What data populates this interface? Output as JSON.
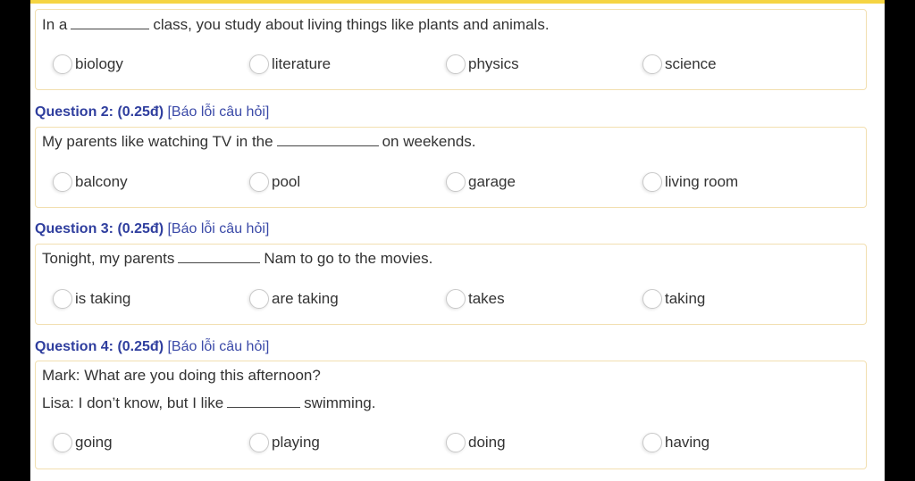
{
  "questions": [
    {
      "header": null,
      "lines": [
        {
          "before": "In a",
          "after": "class, you study about living things like plants and animals."
        }
      ],
      "options": [
        "biology",
        "literature",
        "physics",
        "science"
      ]
    },
    {
      "header": {
        "number": "Question 2: (0.25đ)",
        "link": "[Báo lỗi câu hỏi]"
      },
      "lines": [
        {
          "before": "My parents like watching TV in the",
          "after": "on weekends."
        }
      ],
      "options": [
        "balcony",
        "pool",
        "garage",
        "living room"
      ]
    },
    {
      "header": {
        "number": "Question 3: (0.25đ)",
        "link": "[Báo lỗi câu hỏi]"
      },
      "lines": [
        {
          "before": "Tonight, my parents",
          "after": "Nam to go to the movies."
        }
      ],
      "options": [
        "is taking",
        "are taking",
        "takes",
        "taking"
      ]
    },
    {
      "header": {
        "number": "Question 4: (0.25đ)",
        "link": "[Báo lỗi câu hỏi]"
      },
      "lines": [
        {
          "before": "Mark: What are you doing this afternoon?",
          "after": null
        },
        {
          "before": "Lisa: I don’t know, but I like",
          "after": "swimming."
        }
      ],
      "options": [
        "going",
        "playing",
        "doing",
        "having"
      ]
    }
  ]
}
